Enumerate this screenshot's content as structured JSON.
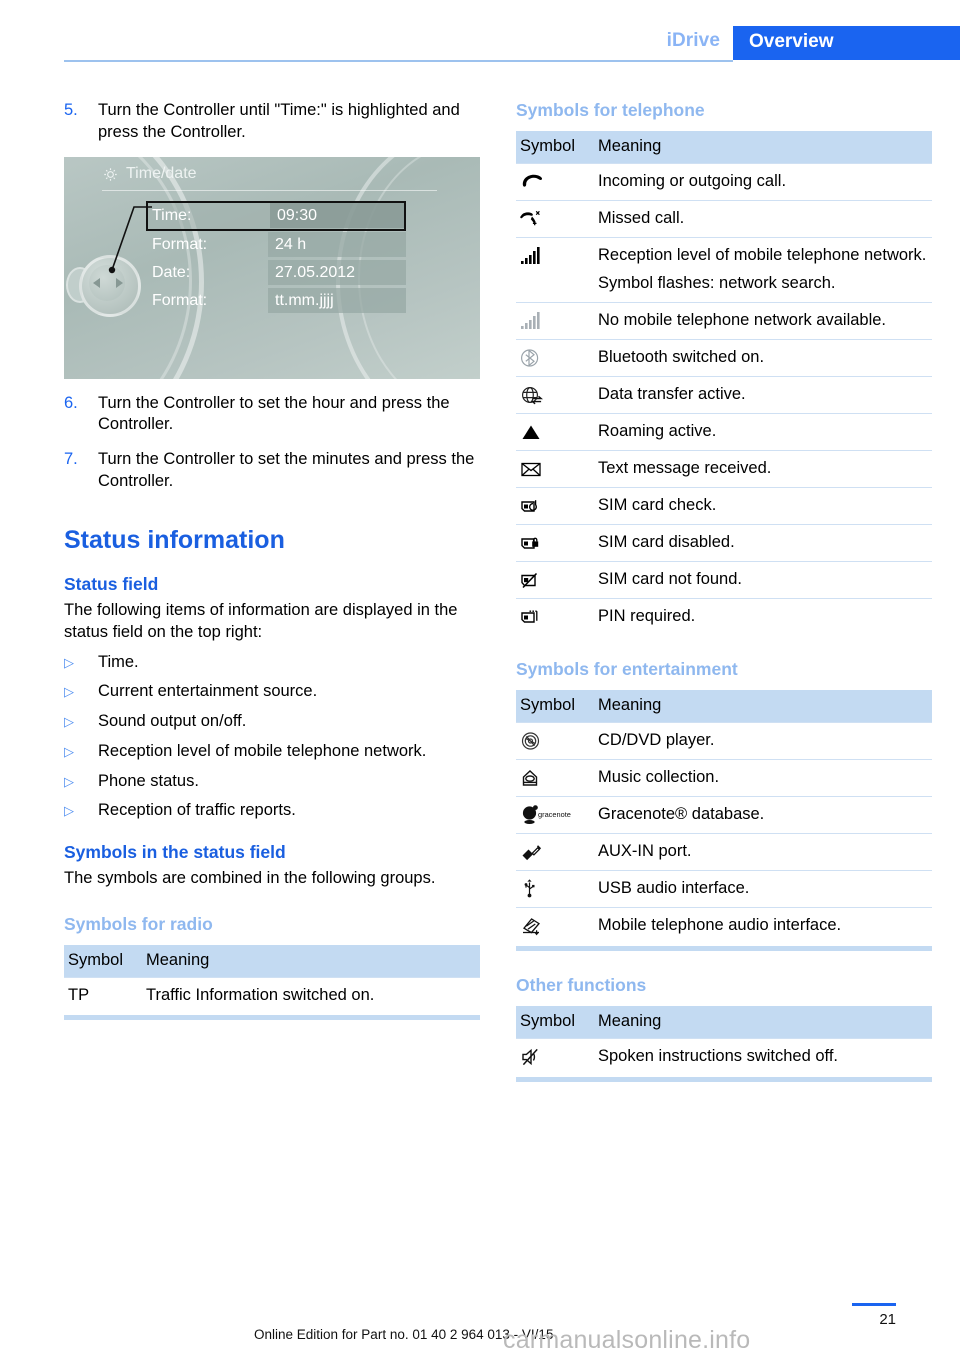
{
  "header": {
    "breadcrumb_section": "iDrive",
    "breadcrumb_page": "Overview"
  },
  "left_column": {
    "steps": [
      {
        "num": "5.",
        "text": "Turn the Controller until \"Time:\" is highlighted and press the Controller."
      },
      {
        "num": "6.",
        "text": "Turn the Controller to set the hour and press the Controller."
      },
      {
        "num": "7.",
        "text": "Turn the Controller to set the minutes and press the Controller."
      }
    ],
    "screenshot": {
      "title": "Time/date",
      "icon": "gear-icon",
      "rows": [
        {
          "label": "Time:",
          "value": "09:30",
          "selected": true
        },
        {
          "label": "Format:",
          "value": "24 h",
          "selected": false
        },
        {
          "label": "Date:",
          "value": "27.05.2012",
          "selected": false
        },
        {
          "label": "Format:",
          "value": "tt.mm.jjjj",
          "selected": false
        }
      ]
    },
    "status_information_heading": "Status information",
    "status_field_heading": "Status field",
    "status_field_intro": "The following items of information are displayed in the status field on the top right:",
    "status_field_items": [
      "Time.",
      "Current entertainment source.",
      "Sound output on/off.",
      "Reception level of mobile telephone network.",
      "Phone status.",
      "Reception of traffic reports."
    ],
    "symbols_status_heading": "Symbols in the status field",
    "symbols_status_intro": "The symbols are combined in the following groups.",
    "symbols_radio_heading": "Symbols for radio",
    "radio_table": {
      "col_symbol": "Symbol",
      "col_meaning": "Meaning",
      "rows": [
        {
          "symbol_text": "TP",
          "symbol_icon": "",
          "meaning": "Traffic Information switched on."
        }
      ]
    }
  },
  "right_column": {
    "symbols_telephone_heading": "Symbols for telephone",
    "telephone_table": {
      "col_symbol": "Symbol",
      "col_meaning": "Meaning",
      "rows": [
        {
          "symbol_icon": "phone-handset-icon",
          "meaning": "Incoming or outgoing call.",
          "note": ""
        },
        {
          "symbol_icon": "missed-call-icon",
          "meaning": "Missed call.",
          "note": ""
        },
        {
          "symbol_icon": "signal-bars-icon",
          "meaning": "Reception level of mobile telephone network.",
          "note": "Symbol flashes: network search."
        },
        {
          "symbol_icon": "signal-bars-grey-icon",
          "meaning": "No mobile telephone network available.",
          "note": ""
        },
        {
          "symbol_icon": "bluetooth-icon",
          "meaning": "Bluetooth switched on.",
          "note": ""
        },
        {
          "symbol_icon": "data-transfer-icon",
          "meaning": "Data transfer active.",
          "note": ""
        },
        {
          "symbol_icon": "roaming-triangle-icon",
          "meaning": "Roaming active.",
          "note": ""
        },
        {
          "symbol_icon": "envelope-icon",
          "meaning": "Text message received.",
          "note": ""
        },
        {
          "symbol_icon": "sim-card-check-icon",
          "meaning": "SIM card check.",
          "note": ""
        },
        {
          "symbol_icon": "sim-card-disabled-icon",
          "meaning": "SIM card disabled.",
          "note": ""
        },
        {
          "symbol_icon": "sim-card-not-found-icon",
          "meaning": "SIM card not found.",
          "note": ""
        },
        {
          "symbol_icon": "sim-card-pin-icon",
          "meaning": "PIN required.",
          "note": ""
        }
      ]
    },
    "symbols_entertainment_heading": "Symbols for entertainment",
    "entertainment_table": {
      "col_symbol": "Symbol",
      "col_meaning": "Meaning",
      "rows": [
        {
          "symbol_icon": "cd-dvd-icon",
          "meaning": "CD/DVD player.",
          "note": ""
        },
        {
          "symbol_icon": "music-collection-icon",
          "meaning": "Music collection.",
          "note": ""
        },
        {
          "symbol_icon": "gracenote-logo-icon",
          "meaning": "Gracenote® database.",
          "note": ""
        },
        {
          "symbol_icon": "aux-in-plug-icon",
          "meaning": "AUX-IN port.",
          "note": ""
        },
        {
          "symbol_icon": "usb-icon",
          "meaning": "USB audio interface.",
          "note": ""
        },
        {
          "symbol_icon": "mobile-audio-interface-icon",
          "meaning": "Mobile telephone audio interface.",
          "note": ""
        }
      ]
    },
    "other_functions_heading": "Other functions",
    "other_table": {
      "col_symbol": "Symbol",
      "col_meaning": "Meaning",
      "rows": [
        {
          "symbol_icon": "speaker-muted-icon",
          "meaning": "Spoken instructions switched off.",
          "note": ""
        }
      ]
    }
  },
  "footer": {
    "edition_text": "Online Edition for Part no. 01 40 2 964 013 - VI/15",
    "page_number": "21",
    "watermark": "carmanualsonline.info"
  },
  "colors": {
    "accent_blue": "#1a64f0",
    "light_blue_heading": "#8fb8ef",
    "table_header_bg": "#c3daf2",
    "rule_blue": "#cfe0f3"
  }
}
